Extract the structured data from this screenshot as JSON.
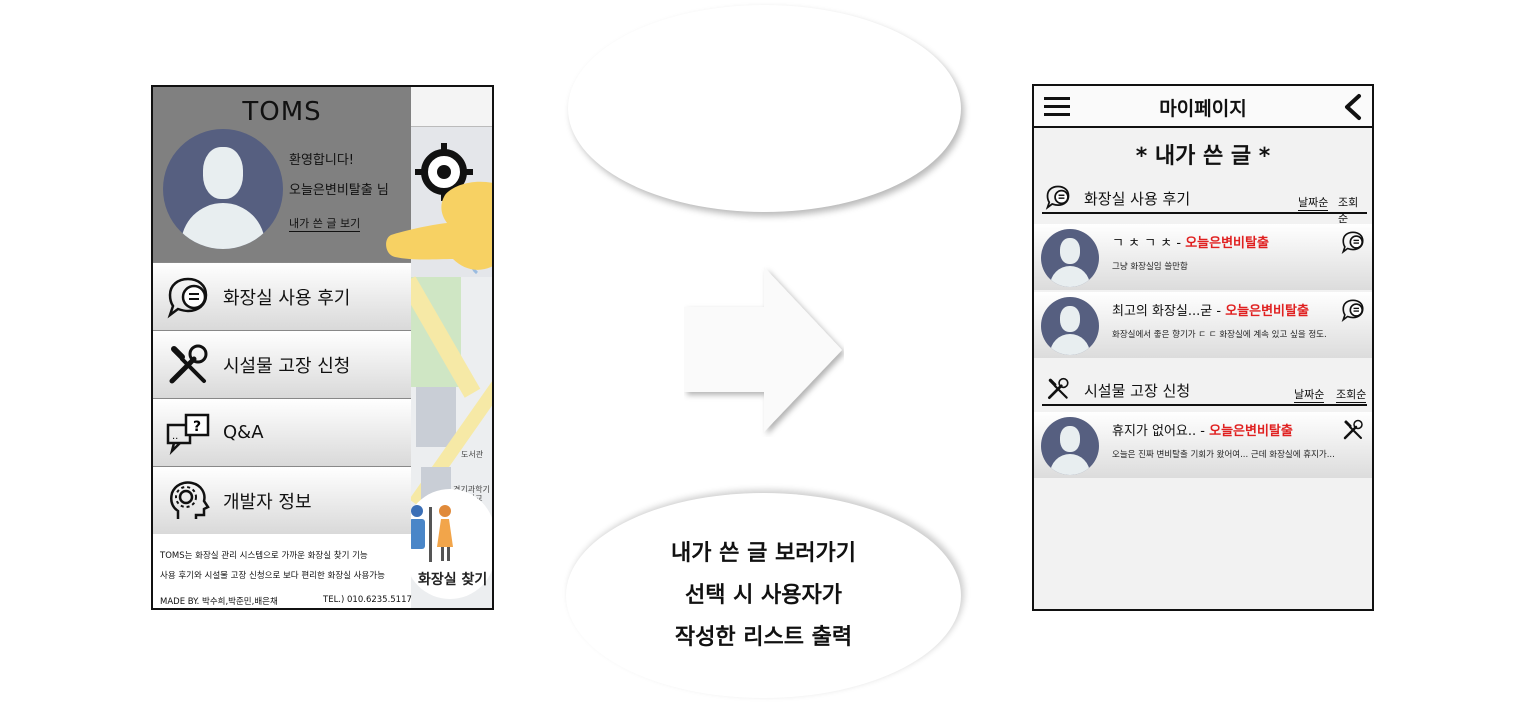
{
  "left_phone": {
    "drawer": {
      "brand": "TOMS",
      "greeting_line1": "환영합니다!",
      "greeting_line2": "오늘은변비탈출 님",
      "my_posts_link": "내가 쓴 글 보기",
      "menu": [
        {
          "label": "화장실 사용 후기",
          "icon": "chat-bubble-icon"
        },
        {
          "label": "시설물 고장 신청",
          "icon": "wrench-screwdriver-icon"
        },
        {
          "label": "Q&A",
          "icon": "question-chat-icon"
        },
        {
          "label": "개발자 정보",
          "icon": "head-gear-icon"
        }
      ],
      "footer_line1": "TOMS는 화장실 관리 시스템으로 가까운 화장실 찾기 기능",
      "footer_line2": "사용 후기와 시설물 고장 신청으로 보다 편리한 화장실 사용가능",
      "footer_made_by": "MADE BY. 박수희,박준민,배은채",
      "footer_tel": "TEL.) 010.6235.5117"
    },
    "map": {
      "label_library": "도서관",
      "label_university": "경기과학기술대학교",
      "toilet_button_label": "화장실 찾기"
    }
  },
  "middle": {
    "caption_lines": [
      "내가 쓴 글 보러가기",
      "선택 시 사용자가",
      "작성한 리스트 출력"
    ]
  },
  "right_phone": {
    "title": "마이페이지",
    "heading": "* 내가 쓴 글 *",
    "sections": [
      {
        "label": "화장실 사용 후기",
        "icon": "chat-bubble-icon",
        "sort_date": "날짜순",
        "sort_views": "조회순",
        "posts": [
          {
            "title": "ㄱ ㅊ ㄱ ㅊ - ",
            "author": "오늘은변비탈출",
            "body": "그냥 화장실임 쓸만함"
          },
          {
            "title": "최고의 화장실...굳 - ",
            "author": "오늘은변비탈출",
            "body": "화장실에서 좋은 향기가 ㄷ ㄷ 화장실에 계속 있고 싶을 정도."
          }
        ]
      },
      {
        "label": "시설물 고장 신청",
        "icon": "wrench-screwdriver-icon",
        "sort_date": "날짜순",
        "sort_views": "조회순",
        "posts": [
          {
            "title": "휴지가 없어요.. - ",
            "author": "오늘은변비탈출",
            "body": "오늘은 진짜 변비탈출 기회가 왔어여... 근데 화장실에 휴지가..."
          }
        ]
      }
    ]
  },
  "colors": {
    "drawer_header": "#808080",
    "avatar": "#565f80",
    "author_tag": "#e02020",
    "hand": "#f7d163"
  }
}
